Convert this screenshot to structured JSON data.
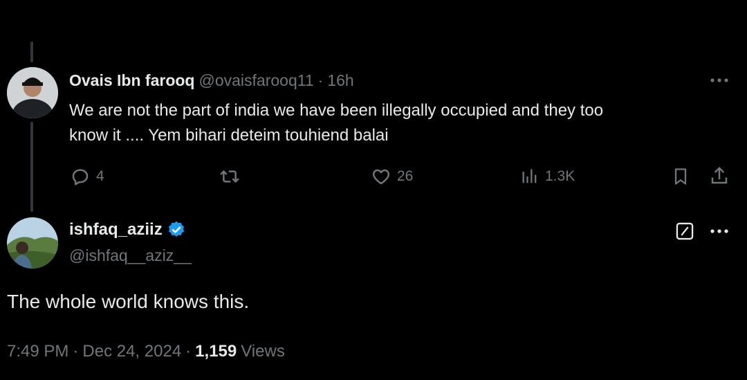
{
  "parent_tweet": {
    "author_name": "Ovais Ibn farooq",
    "handle": "@ovaisfarooq11",
    "separator": "·",
    "time": "16h",
    "text_line1": "We are not the part of india we have been illegally occupied and they too",
    "text_line2": "know it ....  Yem bihari deteim touhiend balai",
    "replies_count": "4",
    "likes_count": "26",
    "views_count": "1.3K"
  },
  "main_tweet": {
    "author_name": "ishfaq_aziiz",
    "handle": "@ishfaq__aziz__",
    "verified": true,
    "text": "The whole world knows this.",
    "time": "7:49 PM",
    "date": "Dec 24, 2024",
    "sep1": "·",
    "sep2": "·",
    "views_number": "1,159",
    "views_label": "Views"
  },
  "colors": {
    "background": "#000000",
    "text": "#e7e9ea",
    "muted": "#71767b",
    "verified_blue": "#1d9bf0",
    "thread_line": "#333639"
  },
  "icons": [
    "more-icon",
    "reply-icon",
    "retweet-icon",
    "like-icon",
    "views-icon",
    "bookmark-icon",
    "share-icon",
    "verified-badge-icon",
    "grok-icon"
  ]
}
